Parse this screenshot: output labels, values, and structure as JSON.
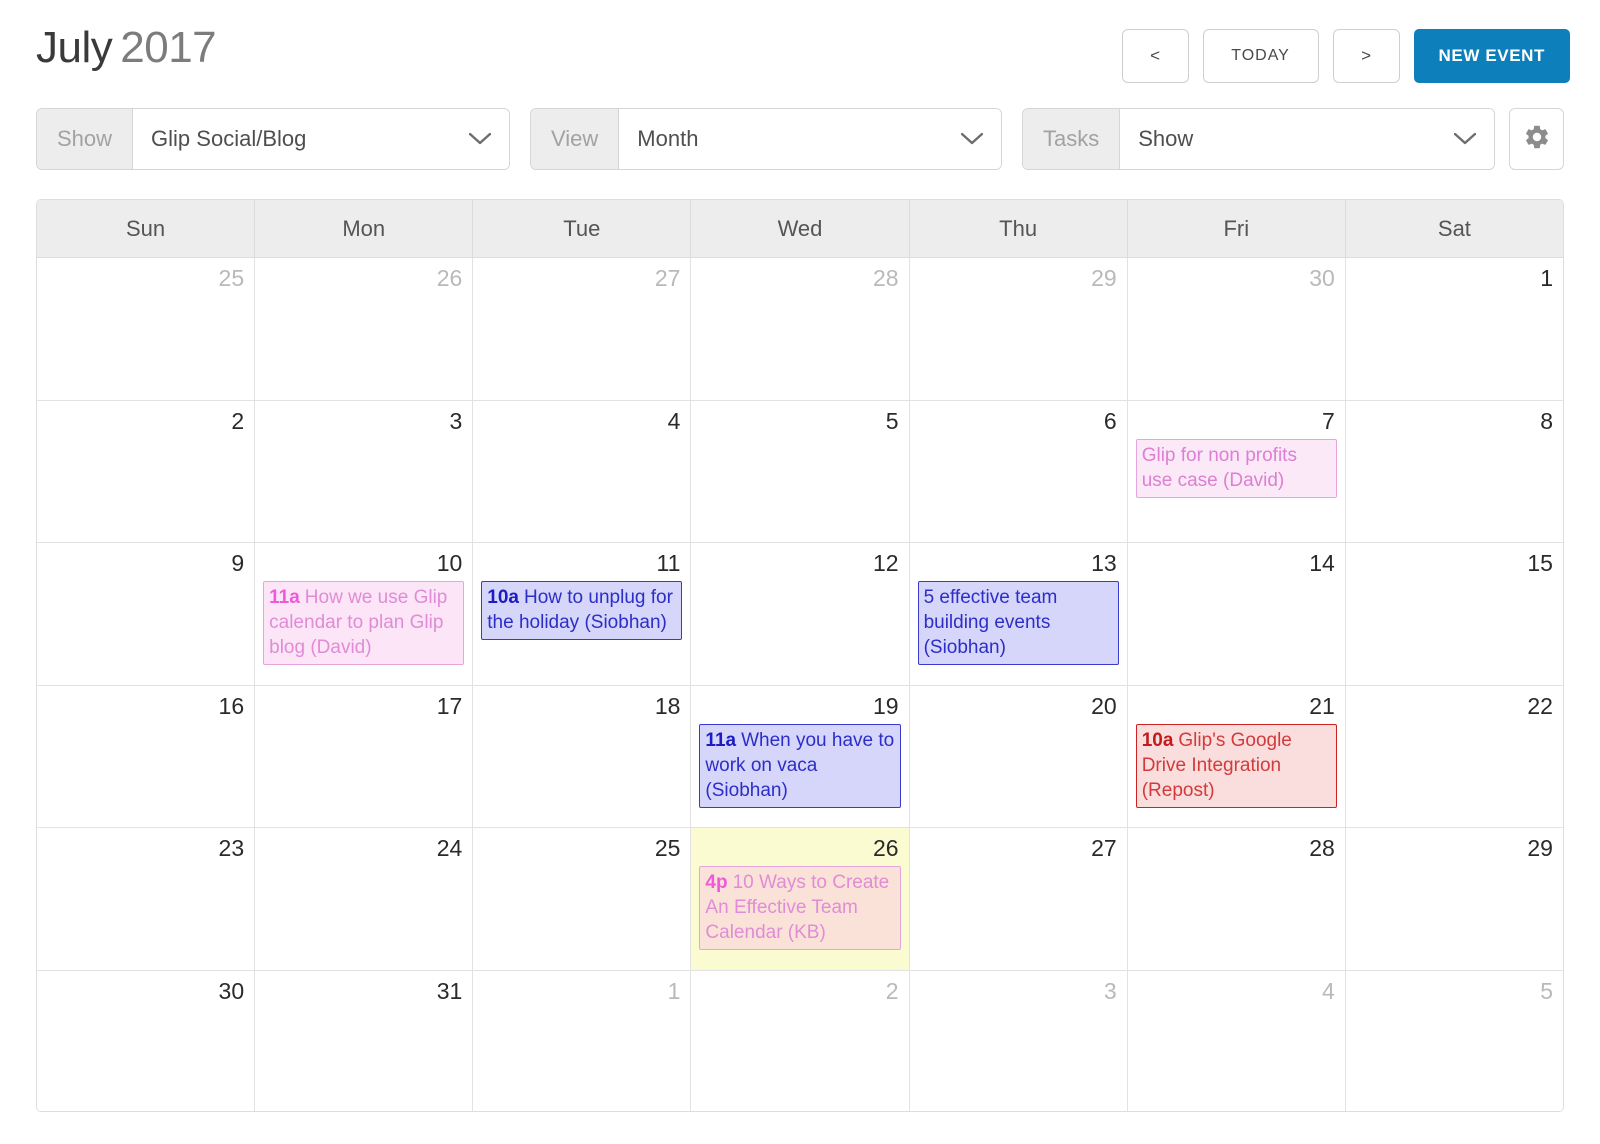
{
  "header": {
    "month": "July",
    "year": "2017",
    "prev_label": "<",
    "today_label": "TODAY",
    "next_label": ">",
    "new_event_label": "NEW EVENT",
    "accent_color": "#0d7fbb"
  },
  "filters": {
    "show": {
      "label": "Show",
      "value": "Glip Social/Blog"
    },
    "view": {
      "label": "View",
      "value": "Month"
    },
    "tasks": {
      "label": "Tasks",
      "value": "Show"
    },
    "settings_icon": "gear-icon"
  },
  "calendar": {
    "weekdays": [
      "Sun",
      "Mon",
      "Tue",
      "Wed",
      "Thu",
      "Fri",
      "Sat"
    ],
    "weeks": [
      [
        {
          "day": "25",
          "other": true,
          "today": false,
          "events": []
        },
        {
          "day": "26",
          "other": true,
          "today": false,
          "events": []
        },
        {
          "day": "27",
          "other": true,
          "today": false,
          "events": []
        },
        {
          "day": "28",
          "other": true,
          "today": false,
          "events": []
        },
        {
          "day": "29",
          "other": true,
          "today": false,
          "events": []
        },
        {
          "day": "30",
          "other": true,
          "today": false,
          "events": []
        },
        {
          "day": "1",
          "other": false,
          "today": false,
          "events": []
        }
      ],
      [
        {
          "day": "2",
          "other": false,
          "today": false,
          "events": []
        },
        {
          "day": "3",
          "other": false,
          "today": false,
          "events": []
        },
        {
          "day": "4",
          "other": false,
          "today": false,
          "events": []
        },
        {
          "day": "5",
          "other": false,
          "today": false,
          "events": []
        },
        {
          "day": "6",
          "other": false,
          "today": false,
          "events": []
        },
        {
          "day": "7",
          "other": false,
          "today": false,
          "events": [
            {
              "time": "",
              "title": "Glip for non profits use case (David)",
              "theme": "ev-pink"
            }
          ]
        },
        {
          "day": "8",
          "other": false,
          "today": false,
          "events": []
        }
      ],
      [
        {
          "day": "9",
          "other": false,
          "today": false,
          "events": []
        },
        {
          "day": "10",
          "other": false,
          "today": false,
          "events": [
            {
              "time": "11a",
              "title": "How we use Glip calendar to plan Glip blog (David)",
              "theme": "ev-pink2"
            }
          ]
        },
        {
          "day": "11",
          "other": false,
          "today": false,
          "events": [
            {
              "time": "10a",
              "title": "How to unplug for the holiday (Siobhan)",
              "theme": "ev-blue"
            }
          ]
        },
        {
          "day": "12",
          "other": false,
          "today": false,
          "events": []
        },
        {
          "day": "13",
          "other": false,
          "today": false,
          "events": [
            {
              "time": "",
              "title": "5 effective team building events (Siobhan)",
              "theme": "ev-blue"
            }
          ]
        },
        {
          "day": "14",
          "other": false,
          "today": false,
          "events": []
        },
        {
          "day": "15",
          "other": false,
          "today": false,
          "events": []
        }
      ],
      [
        {
          "day": "16",
          "other": false,
          "today": false,
          "events": []
        },
        {
          "day": "17",
          "other": false,
          "today": false,
          "events": []
        },
        {
          "day": "18",
          "other": false,
          "today": false,
          "events": []
        },
        {
          "day": "19",
          "other": false,
          "today": false,
          "events": [
            {
              "time": "11a",
              "title": "When you have to work on vaca (Siobhan)",
              "theme": "ev-blue"
            }
          ]
        },
        {
          "day": "20",
          "other": false,
          "today": false,
          "events": []
        },
        {
          "day": "21",
          "other": false,
          "today": false,
          "events": [
            {
              "time": "10a",
              "title": "Glip's Google Drive Integration (Repost)",
              "theme": "ev-red"
            }
          ]
        },
        {
          "day": "22",
          "other": false,
          "today": false,
          "events": []
        }
      ],
      [
        {
          "day": "23",
          "other": false,
          "today": false,
          "events": []
        },
        {
          "day": "24",
          "other": false,
          "today": false,
          "events": []
        },
        {
          "day": "25",
          "other": false,
          "today": false,
          "events": []
        },
        {
          "day": "26",
          "other": false,
          "today": true,
          "events": [
            {
              "time": "4p",
              "title": "10 Ways to Create An Effective Team Calendar (KB)",
              "theme": "ev-peach"
            }
          ]
        },
        {
          "day": "27",
          "other": false,
          "today": false,
          "events": []
        },
        {
          "day": "28",
          "other": false,
          "today": false,
          "events": []
        },
        {
          "day": "29",
          "other": false,
          "today": false,
          "events": []
        }
      ],
      [
        {
          "day": "30",
          "other": false,
          "today": false,
          "events": []
        },
        {
          "day": "31",
          "other": false,
          "today": false,
          "events": []
        },
        {
          "day": "1",
          "other": true,
          "today": false,
          "events": []
        },
        {
          "day": "2",
          "other": true,
          "today": false,
          "events": []
        },
        {
          "day": "3",
          "other": true,
          "today": false,
          "events": []
        },
        {
          "day": "4",
          "other": true,
          "today": false,
          "events": []
        },
        {
          "day": "5",
          "other": true,
          "today": false,
          "events": []
        }
      ]
    ]
  }
}
